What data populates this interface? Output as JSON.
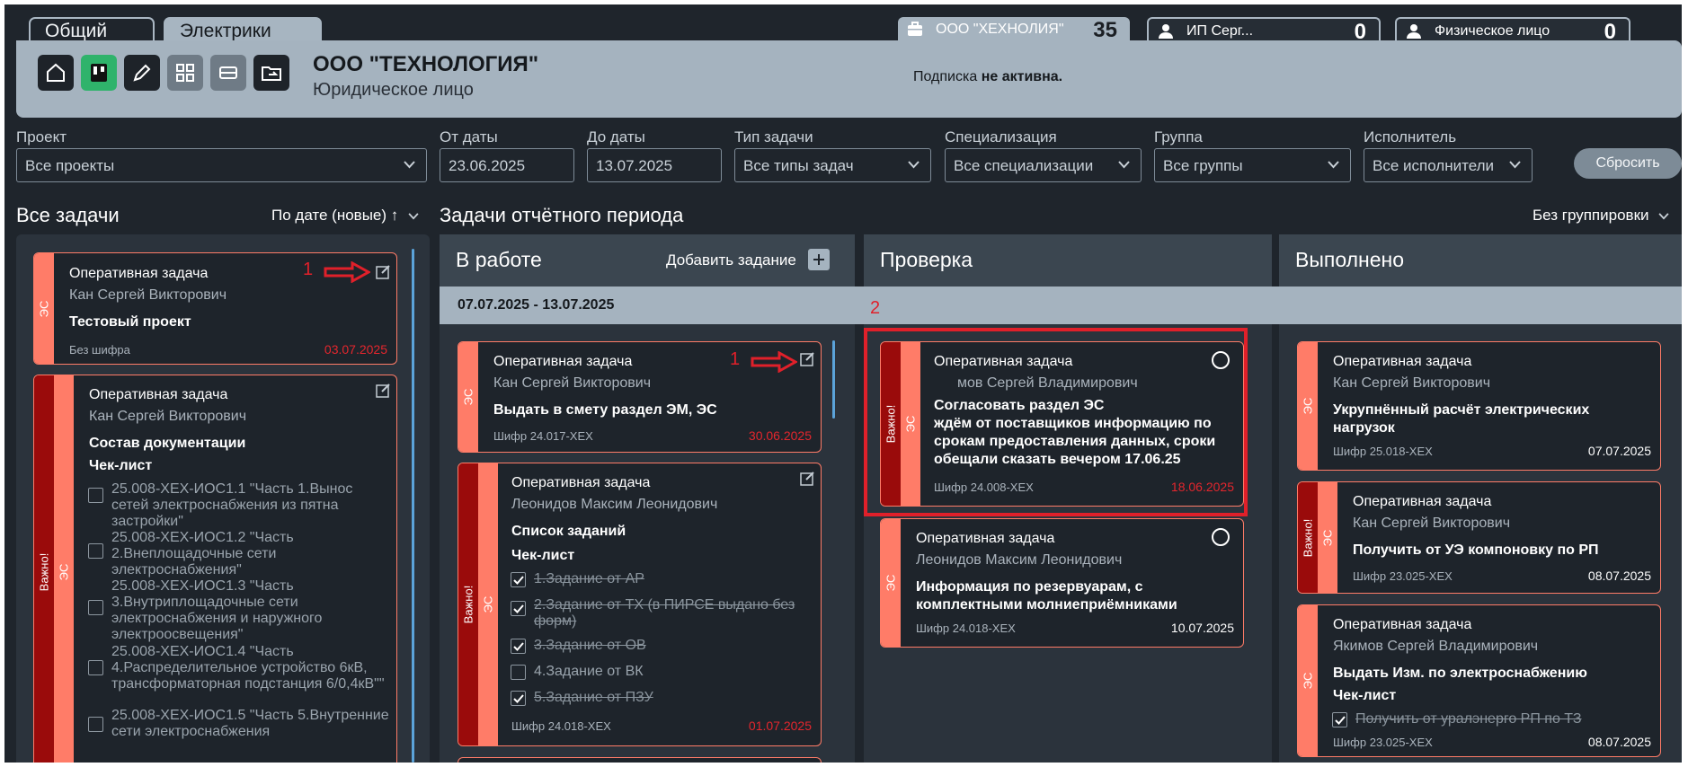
{
  "tabs": [
    {
      "label": "Общий"
    },
    {
      "label": "Электрики"
    }
  ],
  "accounts": [
    {
      "name": "ООО \"ХЕХНОЛИЯ\"",
      "count": "35"
    },
    {
      "name": "ИП Серг...",
      "count": "0"
    },
    {
      "name": "Физическое лицо",
      "count": "0"
    }
  ],
  "company": {
    "name": "ООО \"ТЕХНОЛОГИЯ\"",
    "type": "Юридическое лицо",
    "subscription_prefix": "Подписка",
    "subscription_status": "не активна."
  },
  "toolbar_icons": [
    "home-icon",
    "kanban-icon",
    "pen-icon",
    "grid-icon",
    "list-icon",
    "folder-icon"
  ],
  "filters": {
    "project": {
      "label": "Проект",
      "value": "Все проекты"
    },
    "from": {
      "label": "От даты",
      "value": "23.06.2025"
    },
    "to": {
      "label": "До даты",
      "value": "13.07.2025"
    },
    "task_type": {
      "label": "Тип задачи",
      "value": "Все типы задач"
    },
    "specialization": {
      "label": "Специализация",
      "value": "Все специализации"
    },
    "group": {
      "label": "Группа",
      "value": "Все группы"
    },
    "executor": {
      "label": "Исполнитель",
      "value": "Все исполнители"
    },
    "reset": "Сбросить"
  },
  "all_tasks": {
    "title": "Все задачи",
    "sort": "По дате (новые) ↑"
  },
  "period": {
    "title": "Задачи отчётного периода",
    "grouping": "Без группировки",
    "range": "07.07.2025 - 13.07.2025"
  },
  "columns": {
    "in_work": "В работе",
    "add_task": "Добавить задание",
    "review": "Проверка",
    "done": "Выполнено"
  },
  "left_cards": [
    {
      "title": "Оперативная задача",
      "person": "Кан Сергей Викторович",
      "project": "Тестовый проект",
      "code": "Без шифра",
      "date": "03.07.2025",
      "strip": "ЭС"
    },
    {
      "title": "Оперативная задача",
      "person": "Кан Сергей Викторович",
      "project": "Состав документации",
      "sub": "Чек-лист",
      "strip": "ЭС",
      "important": "Важно!",
      "checklist": [
        "25.008-ХЕХ-ИОС1.1 \"Часть 1.Вынос сетей электроснабжения из пятна застройки\"",
        "25.008-ХЕХ-ИОС1.2 \"Часть 2.Внеплощадочные сети электроснабжения\"",
        "25.008-ХЕХ-ИОС1.3 \"Часть 3.Внутриплощадочные сети электроснабжения и наружного электроосвещения\"",
        "25.008-ХЕХ-ИОС1.4 \"Часть 4.Распределительное устройство 6кВ, трансформаторная подстанция 6/0,4кВ\"\"",
        "25.008-ХЕХ-ИОС1.5 \"Часть 5.Внутренние сети электроснабжения"
      ]
    }
  ],
  "work_cards": [
    {
      "title": "Оперативная задача",
      "person": "Кан Сергей Викторович",
      "project": "Выдать в смету раздел ЭМ, ЭС",
      "code": "Шифр 24.017-ХЕХ",
      "date": "30.06.2025",
      "strip": "ЭС"
    },
    {
      "title": "Оперативная задача",
      "person": "Леонидов  Максим Леонидович",
      "project": "Список заданий",
      "sub": "Чек-лист",
      "code": "Шифр 24.018-ХЕХ",
      "date": "01.07.2025",
      "strip": "ЭС",
      "important": "Важно!",
      "checklist": [
        {
          "text": "1.Задание от АР",
          "done": true
        },
        {
          "text": "2.Задание от ТХ (в ПИРСЕ выдано без форм)",
          "done": true
        },
        {
          "text": "3.Задание от ОВ",
          "done": true
        },
        {
          "text": "4.Задание от ВК",
          "done": false
        },
        {
          "text": "5.Задание от ПЗУ",
          "done": true
        }
      ]
    }
  ],
  "review_cards": [
    {
      "title": "Оперативная задача",
      "person": "мов Сергей Владимирович",
      "project": "Согласовать раздел ЭС\nждём от поставщиков информацию по срокам предоставления данных, сроки обещали сказать вечером 17.06.25",
      "code": "Шифр 24.008-ХЕХ",
      "date": "18.06.2025",
      "strip": "ЭС",
      "important": "Важно!"
    },
    {
      "title": "Оперативная задача",
      "person": "Леонидов Максим Леонидович",
      "project": "Информация по резервуарам, с комплектными молниеприёмниками",
      "code": "Шифр 24.018-ХЕХ",
      "date": "10.07.2025",
      "strip": "ЭС"
    }
  ],
  "done_cards": [
    {
      "title": "Оперативная задача",
      "person": "Кан Сергей Викторович",
      "project": "Укрупнённый расчёт электрических нагрузок",
      "code": "Шифр 25.018-ХЕХ",
      "date": "07.07.2025",
      "strip": "ЭС"
    },
    {
      "title": "Оперативная задача",
      "person": "Кан Сергей Викторович",
      "project": "Получить от УЭ компоновку по РП",
      "code": "Шифр 23.025-ХЕХ",
      "date": "08.07.2025",
      "strip": "ЭС",
      "important": "Важно!"
    },
    {
      "title": "Оперативная задача",
      "person": "Якимов Сергей Владимирович",
      "project": "Выдать Изм.  по электроснабжению",
      "sub": "Чек-лист",
      "code": "Шифр 23.025-ХЕХ",
      "date": "08.07.2025",
      "strip": "ЭС",
      "checklist": [
        {
          "text": "Получить от уралэнерго РП по ТЗ",
          "done": true
        }
      ]
    }
  ],
  "annotations": [
    "1",
    "1",
    "2"
  ],
  "colors": {
    "accent": "#ff7c68",
    "important": "#9a0b0b",
    "header": "#a5b3bf",
    "background": "#1f252c",
    "annotation": "#e0202a"
  }
}
